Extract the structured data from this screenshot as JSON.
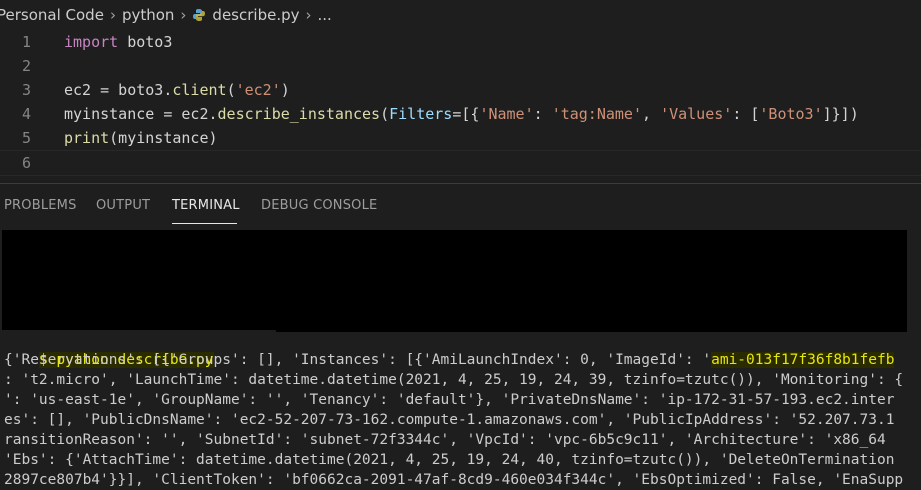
{
  "breadcrumb": {
    "items": [
      "Personal Code",
      "python",
      "describe.py",
      "..."
    ],
    "file_icon": "python-file-icon"
  },
  "editor": {
    "line_numbers": [
      "1",
      "2",
      "3",
      "4",
      "5",
      "6"
    ],
    "lines": [
      [
        {
          "t": "kw",
          "v": "import"
        },
        {
          "t": "plain",
          "v": " boto3"
        }
      ],
      [],
      [
        {
          "t": "plain",
          "v": "ec2 = boto3."
        },
        {
          "t": "fn",
          "v": "client"
        },
        {
          "t": "plain",
          "v": "("
        },
        {
          "t": "str",
          "v": "'ec2'"
        },
        {
          "t": "plain",
          "v": ")"
        }
      ],
      [
        {
          "t": "plain",
          "v": "myinstance = ec2."
        },
        {
          "t": "fn",
          "v": "describe_instances"
        },
        {
          "t": "plain",
          "v": "("
        },
        {
          "t": "param",
          "v": "Filters"
        },
        {
          "t": "plain",
          "v": "=[{"
        },
        {
          "t": "str",
          "v": "'Name'"
        },
        {
          "t": "plain",
          "v": ": "
        },
        {
          "t": "str",
          "v": "'tag:Name'"
        },
        {
          "t": "plain",
          "v": ", "
        },
        {
          "t": "str",
          "v": "'Values'"
        },
        {
          "t": "plain",
          "v": ": ["
        },
        {
          "t": "str",
          "v": "'Boto3'"
        },
        {
          "t": "plain",
          "v": "]}])"
        }
      ],
      [
        {
          "t": "fn",
          "v": "print"
        },
        {
          "t": "plain",
          "v": "(myinstance)"
        }
      ],
      []
    ]
  },
  "panel": {
    "tabs": [
      "PROBLEMS",
      "OUTPUT",
      "TERMINAL",
      "DEBUG CONSOLE"
    ],
    "active_tab": "TERMINAL"
  },
  "terminal": {
    "prompt_line": "$ python describe.py",
    "output": [
      "{'Reservations': [{'Groups': [], 'Instances': [{'AmiLaunchIndex': 0, 'ImageId': 'ami-013f17f36f8b1fefb",
      ": 't2.micro', 'LaunchTime': datetime.datetime(2021, 4, 25, 19, 24, 39, tzinfo=tzutc()), 'Monitoring': {",
      "': 'us-east-1e', 'GroupName': '', 'Tenancy': 'default'}, 'PrivateDnsName': 'ip-172-31-57-193.ec2.inter",
      "es': [], 'PublicDnsName': 'ec2-52-207-73-162.compute-1.amazonaws.com', 'PublicIpAddress': '52.207.73.1",
      "ransitionReason': '', 'SubnetId': 'subnet-72f3344c', 'VpcId': 'vpc-6b5c9c11', 'Architecture': 'x86_64",
      "'Ebs': {'AttachTime': datetime.datetime(2021, 4, 25, 19, 24, 40, tzinfo=tzutc()), 'DeleteOnTermination",
      "2897ce807b4'}}], 'ClientToken': 'bf0662ca-2091-47af-8cd9-460e034f344c', 'EbsOptimized': False, 'EnaSupp"
    ],
    "highlight_value": "ami-013f17f36f8b1fefb"
  },
  "colors": {
    "keyword": "#c586c0",
    "function": "#dcdcaa",
    "string": "#ce9178",
    "param": "#9cdcfe",
    "terminal_highlight": "#e5e510"
  }
}
